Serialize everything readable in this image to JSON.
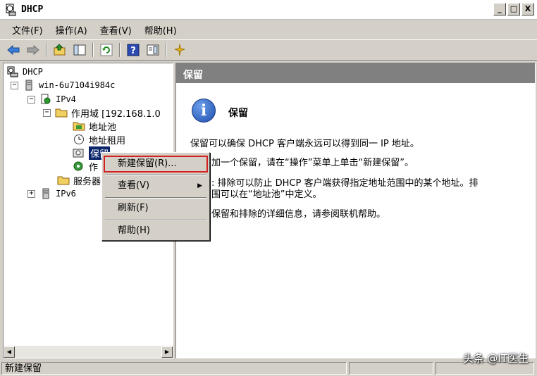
{
  "window": {
    "title": "DHCP"
  },
  "window_buttons": {
    "minimize": "_",
    "maximize": "□",
    "close": "X"
  },
  "menubar": [
    {
      "label": "文件(F)"
    },
    {
      "label": "操作(A)"
    },
    {
      "label": "查看(V)"
    },
    {
      "label": "帮助(H)"
    }
  ],
  "toolbar": {
    "buttons": [
      "back-icon",
      "forward-icon",
      "up-folder-icon",
      "show-hide-tree-icon",
      "refresh-icon",
      "help-icon",
      "properties-icon",
      "star-icon"
    ]
  },
  "tree": {
    "root": "DHCP",
    "server": "win-6u7104i984c",
    "ipv4": "IPv4",
    "scope": "作用域 [192.168.1.0",
    "address_pool": "地址池",
    "address_leases": "地址租用",
    "reservations": "保留",
    "scope_options": "作",
    "server_options": "服务器",
    "ipv6": "IPv6"
  },
  "right_pane": {
    "header": "保留",
    "title": "保留",
    "para1": "保留可以确保 DHCP 客户端永远可以得到同一 IP 地址。",
    "para2": "加一个保留，请在“操作”菜单上单击“新建保留”。",
    "para3a": ": 排除可以防止 DHCP 客户端获得指定地址范围中的某个地址。排",
    "para3b": "围可以在“地址池”中定义。",
    "para4": "保留和排除的详细信息，请参阅联机帮助。"
  },
  "context_menu": {
    "items": [
      {
        "label": "新建保留(R)..."
      },
      {
        "label": "查看(V)"
      },
      {
        "label": "刷新(F)"
      },
      {
        "label": "帮助(H)"
      }
    ]
  },
  "statusbar": {
    "text": "新建保留"
  },
  "watermark": "头条 @IT医生",
  "colors": {
    "selection": "#0a246a",
    "highlight_box": "#d42020",
    "header_bg": "#808080"
  }
}
